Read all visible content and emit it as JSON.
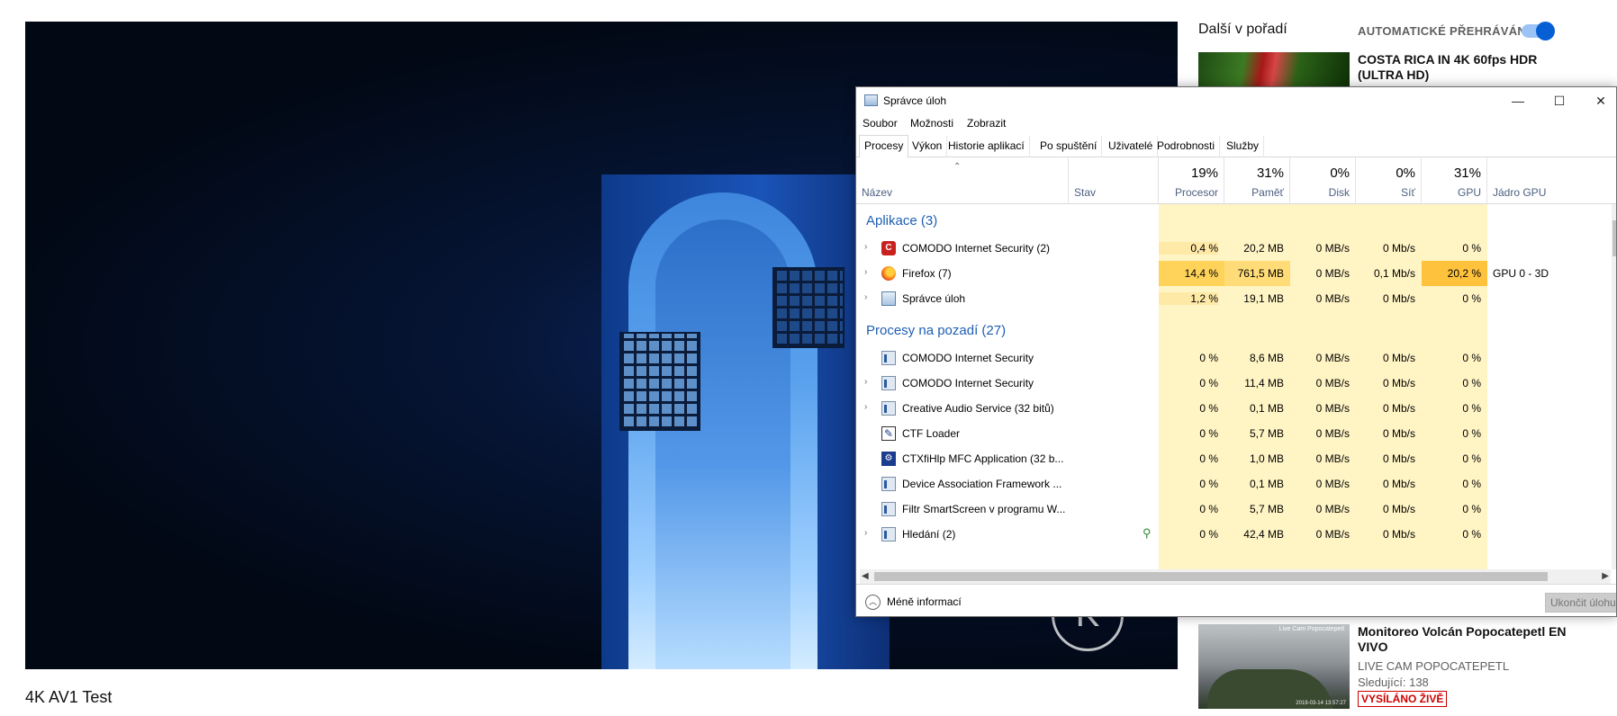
{
  "video": {
    "title": "4K AV1 Test",
    "overlay_logo": "K"
  },
  "sidebar": {
    "header": "Další v pořadí",
    "autoplay_label": "AUTOMATICKÉ PŘEHRÁVÁNÍ",
    "autoplay_on": true,
    "recommendations": [
      {
        "title": "COSTA RICA IN 4K 60fps HDR (ULTRA HD)"
      },
      {
        "title": "Monitoreo Volcán Popocatepetl EN VIVO",
        "channel": "LIVE CAM POPOCATEPETL",
        "viewers": "Sledující: 138",
        "badge": "VYSÍLÁNO ŽIVĚ",
        "thumb_tag": "Live Cam Popocatepetl",
        "thumb_stamp": "2019-03-14 13:57:27"
      }
    ]
  },
  "taskmanager": {
    "title": "Správce úloh",
    "window_buttons": {
      "minimize": "—",
      "maximize": "☐",
      "close": "✕"
    },
    "menu": [
      "Soubor",
      "Možnosti",
      "Zobrazit"
    ],
    "tabs": [
      "Procesy",
      "Výkon",
      "Historie aplikací",
      "Po spuštění",
      "Uživatelé",
      "Podrobnosti",
      "Služby"
    ],
    "columns": {
      "name": "Název",
      "status": "Stav",
      "cpu": {
        "pct": "19%",
        "label": "Procesor"
      },
      "memory": {
        "pct": "31%",
        "label": "Paměť"
      },
      "disk": {
        "pct": "0%",
        "label": "Disk"
      },
      "network": {
        "pct": "0%",
        "label": "Síť"
      },
      "gpu": {
        "pct": "31%",
        "label": "GPU"
      },
      "gpu_engine": "Jádro GPU"
    },
    "groups": {
      "apps": {
        "title": "Aplikace (3)",
        "rows": [
          {
            "name": "COMODO Internet Security (2)",
            "icon": "comodo-icon",
            "cpu": "0,4 %",
            "mem": "20,2 MB",
            "disk": "0 MB/s",
            "net": "0 Mb/s",
            "gpu": "0 %",
            "engine": ""
          },
          {
            "name": "Firefox (7)",
            "icon": "firefox-icon",
            "cpu": "14,4 %",
            "mem": "761,5 MB",
            "disk": "0 MB/s",
            "net": "0,1 Mb/s",
            "gpu": "20,2 %",
            "engine": "GPU 0 - 3D"
          },
          {
            "name": "Správce úloh",
            "icon": "taskmanager-icon",
            "cpu": "1,2 %",
            "mem": "19,1 MB",
            "disk": "0 MB/s",
            "net": "0 Mb/s",
            "gpu": "0 %",
            "engine": ""
          }
        ]
      },
      "background": {
        "title": "Procesy na pozadí (27)",
        "rows": [
          {
            "name": "COMODO Internet Security",
            "icon": "service-icon",
            "cpu": "0 %",
            "mem": "8,6 MB",
            "disk": "0 MB/s",
            "net": "0 Mb/s",
            "gpu": "0 %"
          },
          {
            "name": "COMODO Internet Security",
            "icon": "service-icon",
            "cpu": "0 %",
            "mem": "11,4 MB",
            "disk": "0 MB/s",
            "net": "0 Mb/s",
            "gpu": "0 %"
          },
          {
            "name": "Creative Audio Service (32 bitů)",
            "icon": "service-icon",
            "cpu": "0 %",
            "mem": "0,1 MB",
            "disk": "0 MB/s",
            "net": "0 Mb/s",
            "gpu": "0 %"
          },
          {
            "name": "CTF Loader",
            "icon": "ctf-icon",
            "cpu": "0 %",
            "mem": "5,7 MB",
            "disk": "0 MB/s",
            "net": "0 Mb/s",
            "gpu": "0 %"
          },
          {
            "name": "CTXfiHlp MFC Application (32 b...",
            "icon": "ctx-icon",
            "cpu": "0 %",
            "mem": "1,0 MB",
            "disk": "0 MB/s",
            "net": "0 Mb/s",
            "gpu": "0 %"
          },
          {
            "name": "Device Association Framework ...",
            "icon": "service-icon",
            "cpu": "0 %",
            "mem": "0,1 MB",
            "disk": "0 MB/s",
            "net": "0 Mb/s",
            "gpu": "0 %"
          },
          {
            "name": "Filtr SmartScreen v programu W...",
            "icon": "service-icon",
            "cpu": "0 %",
            "mem": "5,7 MB",
            "disk": "0 MB/s",
            "net": "0 Mb/s",
            "gpu": "0 %"
          },
          {
            "name": "Hledání (2)",
            "icon": "service-icon",
            "cpu": "0 %",
            "mem": "42,4 MB",
            "disk": "0 MB/s",
            "net": "0 Mb/s",
            "gpu": "0 %"
          }
        ]
      }
    },
    "footer": {
      "less_info": "Méně informací",
      "end_task": "Ukončit úlohu"
    }
  }
}
